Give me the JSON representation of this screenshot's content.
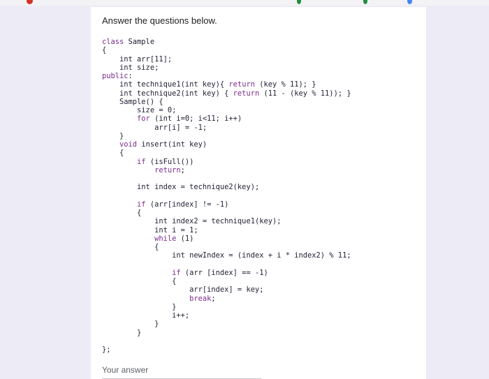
{
  "form": {
    "question_title": "Answer the questions below.",
    "code_lines": [
      "class Sample",
      "{",
      "    int arr[11];",
      "    int size;",
      "public:",
      "    int technique1(int key){ return (key % 11); }",
      "    int technique2(int key) { return (11 - (key % 11)); }",
      "    Sample() {",
      "        size = 0;",
      "        for (int i=0; i<11; i++)",
      "            arr[i] = -1;",
      "    }",
      "    void insert(int key)",
      "    {",
      "        if (isFull())",
      "            return;",
      "",
      "        int index = technique2(key);",
      "",
      "        if (arr[index] != -1)",
      "        {",
      "            int index2 = technique1(key);",
      "            int i = 1;",
      "            while (1)",
      "            {",
      "                int newIndex = (index + i * index2) % 11;",
      "",
      "                if (arr [index] == -1)",
      "                {",
      "                    arr[index] = key;",
      "                    break;",
      "                }",
      "                i++;",
      "            }",
      "        }",
      "",
      "};"
    ],
    "answer_placeholder": "Your answer"
  },
  "colors": {
    "page_background": "#ecebf6",
    "card_background": "#ffffff",
    "code_text": "#1f1f33",
    "keyword": "#7a2b8c"
  }
}
